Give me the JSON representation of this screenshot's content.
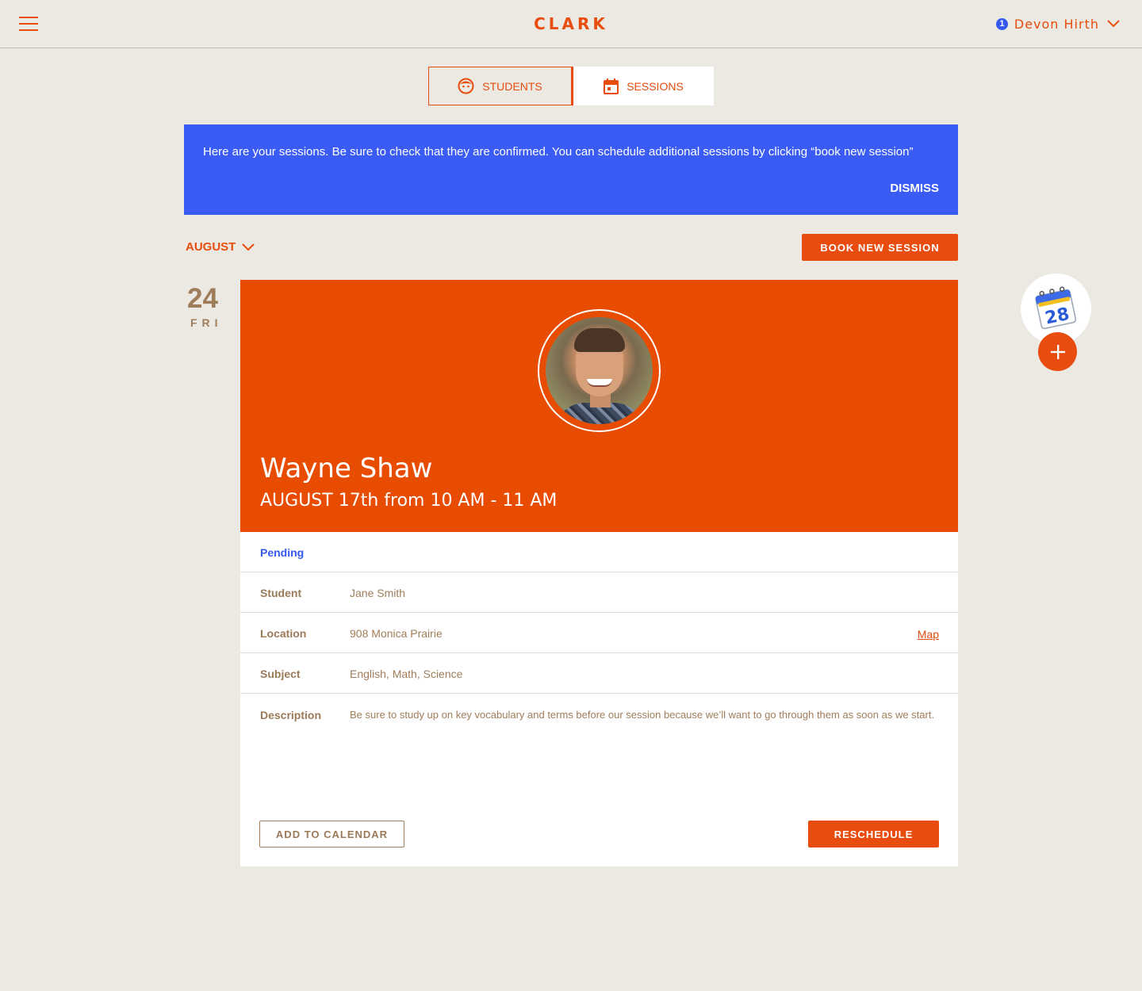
{
  "header": {
    "logo": "CLARK",
    "notification_count": "1",
    "user_name": "Devon Hirth"
  },
  "tabs": [
    {
      "label": "STUDENTS",
      "icon": "student-face-icon",
      "active": false
    },
    {
      "label": "SESSIONS",
      "icon": "calendar-icon",
      "active": true
    }
  ],
  "banner": {
    "message": "Here are your sessions. Be sure to check that they are confirmed. You can schedule additional sessions by clicking “book new session”",
    "dismiss_label": "DISMISS"
  },
  "month_selector": {
    "label": "AUGUST"
  },
  "book_button": "BOOK NEW SESSION",
  "date": {
    "number": "24",
    "weekday": "FRI"
  },
  "session": {
    "tutor_name": "Wayne Shaw",
    "time": "AUGUST 17th from 10 AM - 11 AM",
    "status": "Pending",
    "student_label": "Student",
    "student_value": "Jane Smith",
    "location_label": "Location",
    "location_value": "908 Monica Prairie",
    "map_link": "Map",
    "subject_label": "Subject",
    "subject_value": "English, Math, Science",
    "description_label": "Description",
    "description_value": "Be sure to study up on key vocabulary and terms before our session because we’ll want to go through them as soon as we start.",
    "add_to_calendar": "ADD TO CALENDAR",
    "reschedule": "RESCHEDULE"
  },
  "floating_widget": {
    "calendar_day": "28"
  },
  "colors": {
    "accent": "#e84c0e",
    "banner": "#3a5cf5",
    "background": "#ece9e2",
    "pending": "#3458f0"
  }
}
